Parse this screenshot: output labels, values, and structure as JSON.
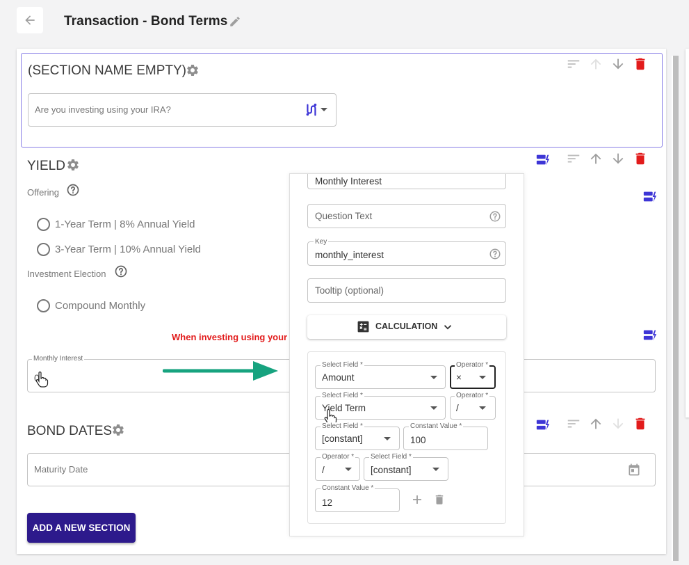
{
  "header": {
    "title": "Transaction - Bond Terms"
  },
  "sections": {
    "empty": {
      "title": "(SECTION NAME EMPTY)",
      "question_placeholder": "Are you investing using your IRA?"
    },
    "yield": {
      "title": "YIELD",
      "offering_label": "Offering",
      "options": [
        "1-Year Term | 8% Annual Yield",
        "3-Year Term | 10% Annual Yield"
      ],
      "election_label": "Investment Election",
      "election_options": [
        "Compound Monthly"
      ],
      "warning": "When investing using your IR",
      "monthly_interest_label": "Monthly Interest",
      "monthly_interest_value": "0"
    },
    "bond_dates": {
      "title": "BOND DATES",
      "maturity_placeholder": "Maturity Date"
    }
  },
  "add_section_label": "ADD A NEW SECTION",
  "editor": {
    "name_value": "Monthly Interest",
    "question_placeholder": "Question Text",
    "key_label": "Key",
    "key_value": "monthly_interest",
    "tooltip_placeholder": "Tooltip (optional)",
    "calc_label": "CALCULATION",
    "rows": [
      {
        "field_label": "Select Field *",
        "field_value": "Amount",
        "op_label": "Operator *",
        "op_value": "×"
      },
      {
        "field_label": "Select Field *",
        "field_value": "Yield Term",
        "op_label": "Operator *",
        "op_value": "/"
      },
      {
        "field_label": "Select Field *",
        "field_value": "[constant]",
        "const_label": "Constant Value *",
        "const_value": "100"
      },
      {
        "op_label": "Operator *",
        "op_value": "/",
        "field_label": "Select Field *",
        "field_value": "[constant]"
      },
      {
        "const_label": "Constant Value *",
        "const_value": "12"
      }
    ]
  },
  "colors": {
    "accent": "#2d1a8c",
    "icon_blue": "#3d35d6",
    "danger": "#e21b1b",
    "arrow": "#17a37f"
  },
  "icons": [
    "back-arrow-icon",
    "pencil-icon",
    "gear-icon",
    "sort-icon",
    "arrow-up-icon",
    "arrow-down-icon",
    "trash-icon",
    "logic-icon",
    "dropdown-icon",
    "help-icon",
    "calculator-icon",
    "chevron-down-icon",
    "plus-icon",
    "calendar-icon",
    "cursor-hand-icon",
    "green-arrow-icon"
  ]
}
